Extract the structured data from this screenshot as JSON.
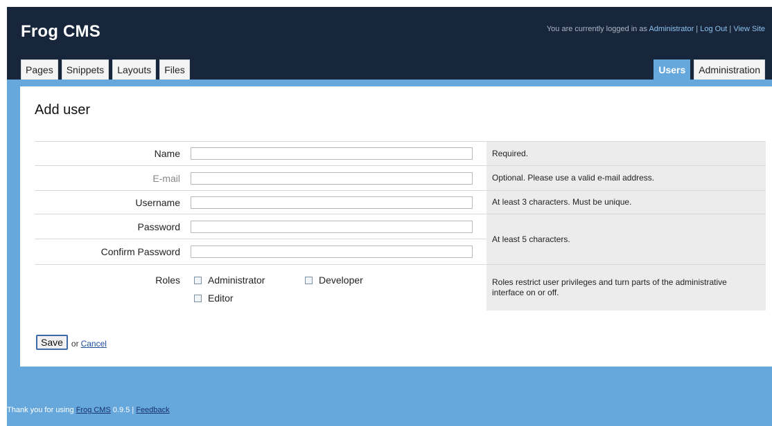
{
  "header": {
    "app_title": "Frog CMS",
    "login_text": "You are currently logged in as",
    "user_link": "Administrator",
    "separator": "|",
    "logout_link": "Log Out",
    "viewsite_link": "View Site"
  },
  "tabs": {
    "left": [
      {
        "label": "Pages"
      },
      {
        "label": "Snippets"
      },
      {
        "label": "Layouts"
      },
      {
        "label": "Files"
      }
    ],
    "right": [
      {
        "label": "Users",
        "active": true
      },
      {
        "label": "Administration"
      }
    ]
  },
  "page": {
    "title": "Add user"
  },
  "form": {
    "name": {
      "label": "Name",
      "value": "",
      "help": "Required."
    },
    "email": {
      "label": "E-mail",
      "value": "",
      "help": "Optional. Please use a valid e-mail address."
    },
    "username": {
      "label": "Username",
      "value": "",
      "help": "At least 3 characters. Must be unique."
    },
    "password": {
      "label": "Password",
      "value": ""
    },
    "confirm_password": {
      "label": "Confirm Password",
      "value": ""
    },
    "password_help": "At least 5 characters.",
    "roles": {
      "label": "Roles",
      "options": [
        {
          "label": "Administrator",
          "checked": false
        },
        {
          "label": "Developer",
          "checked": false
        },
        {
          "label": "Editor",
          "checked": false
        }
      ],
      "help": "Roles restrict user privileges and turn parts of the administrative interface on or off."
    }
  },
  "actions": {
    "save_label": "Save",
    "or_text": "or",
    "cancel_label": "Cancel"
  },
  "footer": {
    "prefix": "Thank you for using",
    "product_link": "Frog CMS",
    "version": "0.9.5",
    "separator": "|",
    "feedback_link": "Feedback"
  },
  "colors": {
    "header_bg": "#17263a",
    "frame_bg": "#66a8dc",
    "active_tab": "#66a8dc",
    "help_bg": "#ececec"
  }
}
